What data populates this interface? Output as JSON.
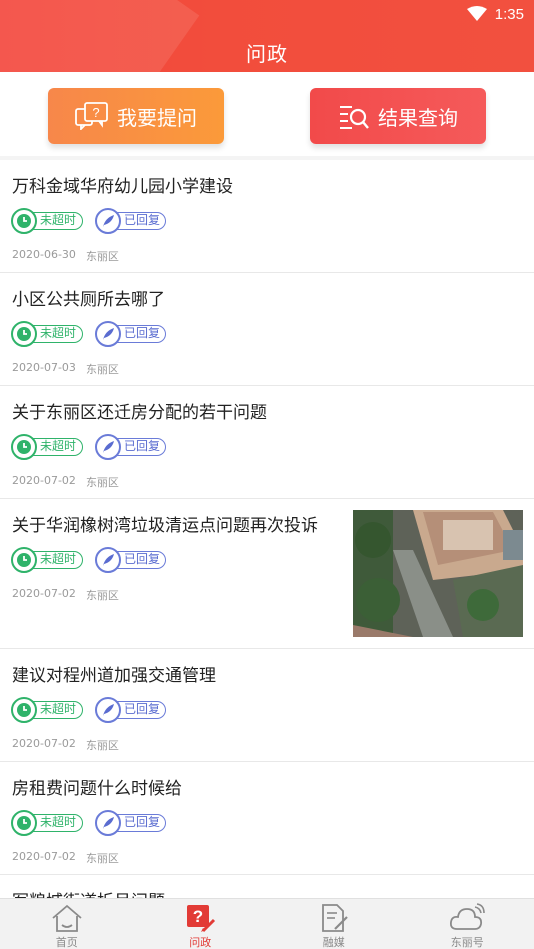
{
  "status_bar": {
    "time": "1:35"
  },
  "header": {
    "title": "问政"
  },
  "actions": {
    "ask_label": "我要提问",
    "query_label": "结果查询"
  },
  "list": {
    "items": [
      {
        "title": "万科金域华府幼儿园小学建设",
        "status_time": "未超时",
        "status_reply": "已回复",
        "date": "2020-06-30",
        "district": "东丽区"
      },
      {
        "title": "小区公共厕所去哪了",
        "status_time": "未超时",
        "status_reply": "已回复",
        "date": "2020-07-03",
        "district": "东丽区"
      },
      {
        "title": "关于东丽区还迁房分配的若干问题",
        "status_time": "未超时",
        "status_reply": "已回复",
        "date": "2020-07-02",
        "district": "东丽区"
      },
      {
        "title": "关于华润橡树湾垃圾清运点问题再次投诉",
        "status_time": "未超时",
        "status_reply": "已回复",
        "date": "2020-07-02",
        "district": "东丽区"
      },
      {
        "title": "建议对程州道加强交通管理",
        "status_time": "未超时",
        "status_reply": "已回复",
        "date": "2020-07-02",
        "district": "东丽区"
      },
      {
        "title": "房租费问题什么时候给",
        "status_time": "未超时",
        "status_reply": "已回复",
        "date": "2020-07-02",
        "district": "东丽区"
      },
      {
        "title": "军粮城街道拆吊问题"
      }
    ]
  },
  "bottom_nav": {
    "items": [
      {
        "label": "首页",
        "icon": "home-icon"
      },
      {
        "label": "问政",
        "icon": "question-icon"
      },
      {
        "label": "融媒",
        "icon": "media-icon"
      },
      {
        "label": "东丽号",
        "icon": "cloud-icon"
      }
    ],
    "active_color": "#e23b36"
  },
  "colors": {
    "header": "#f2473b",
    "ask_button": "#f98d45",
    "query_button": "#f34d4d",
    "status_green": "#2fb36a",
    "status_blue": "#6a7bd8"
  }
}
